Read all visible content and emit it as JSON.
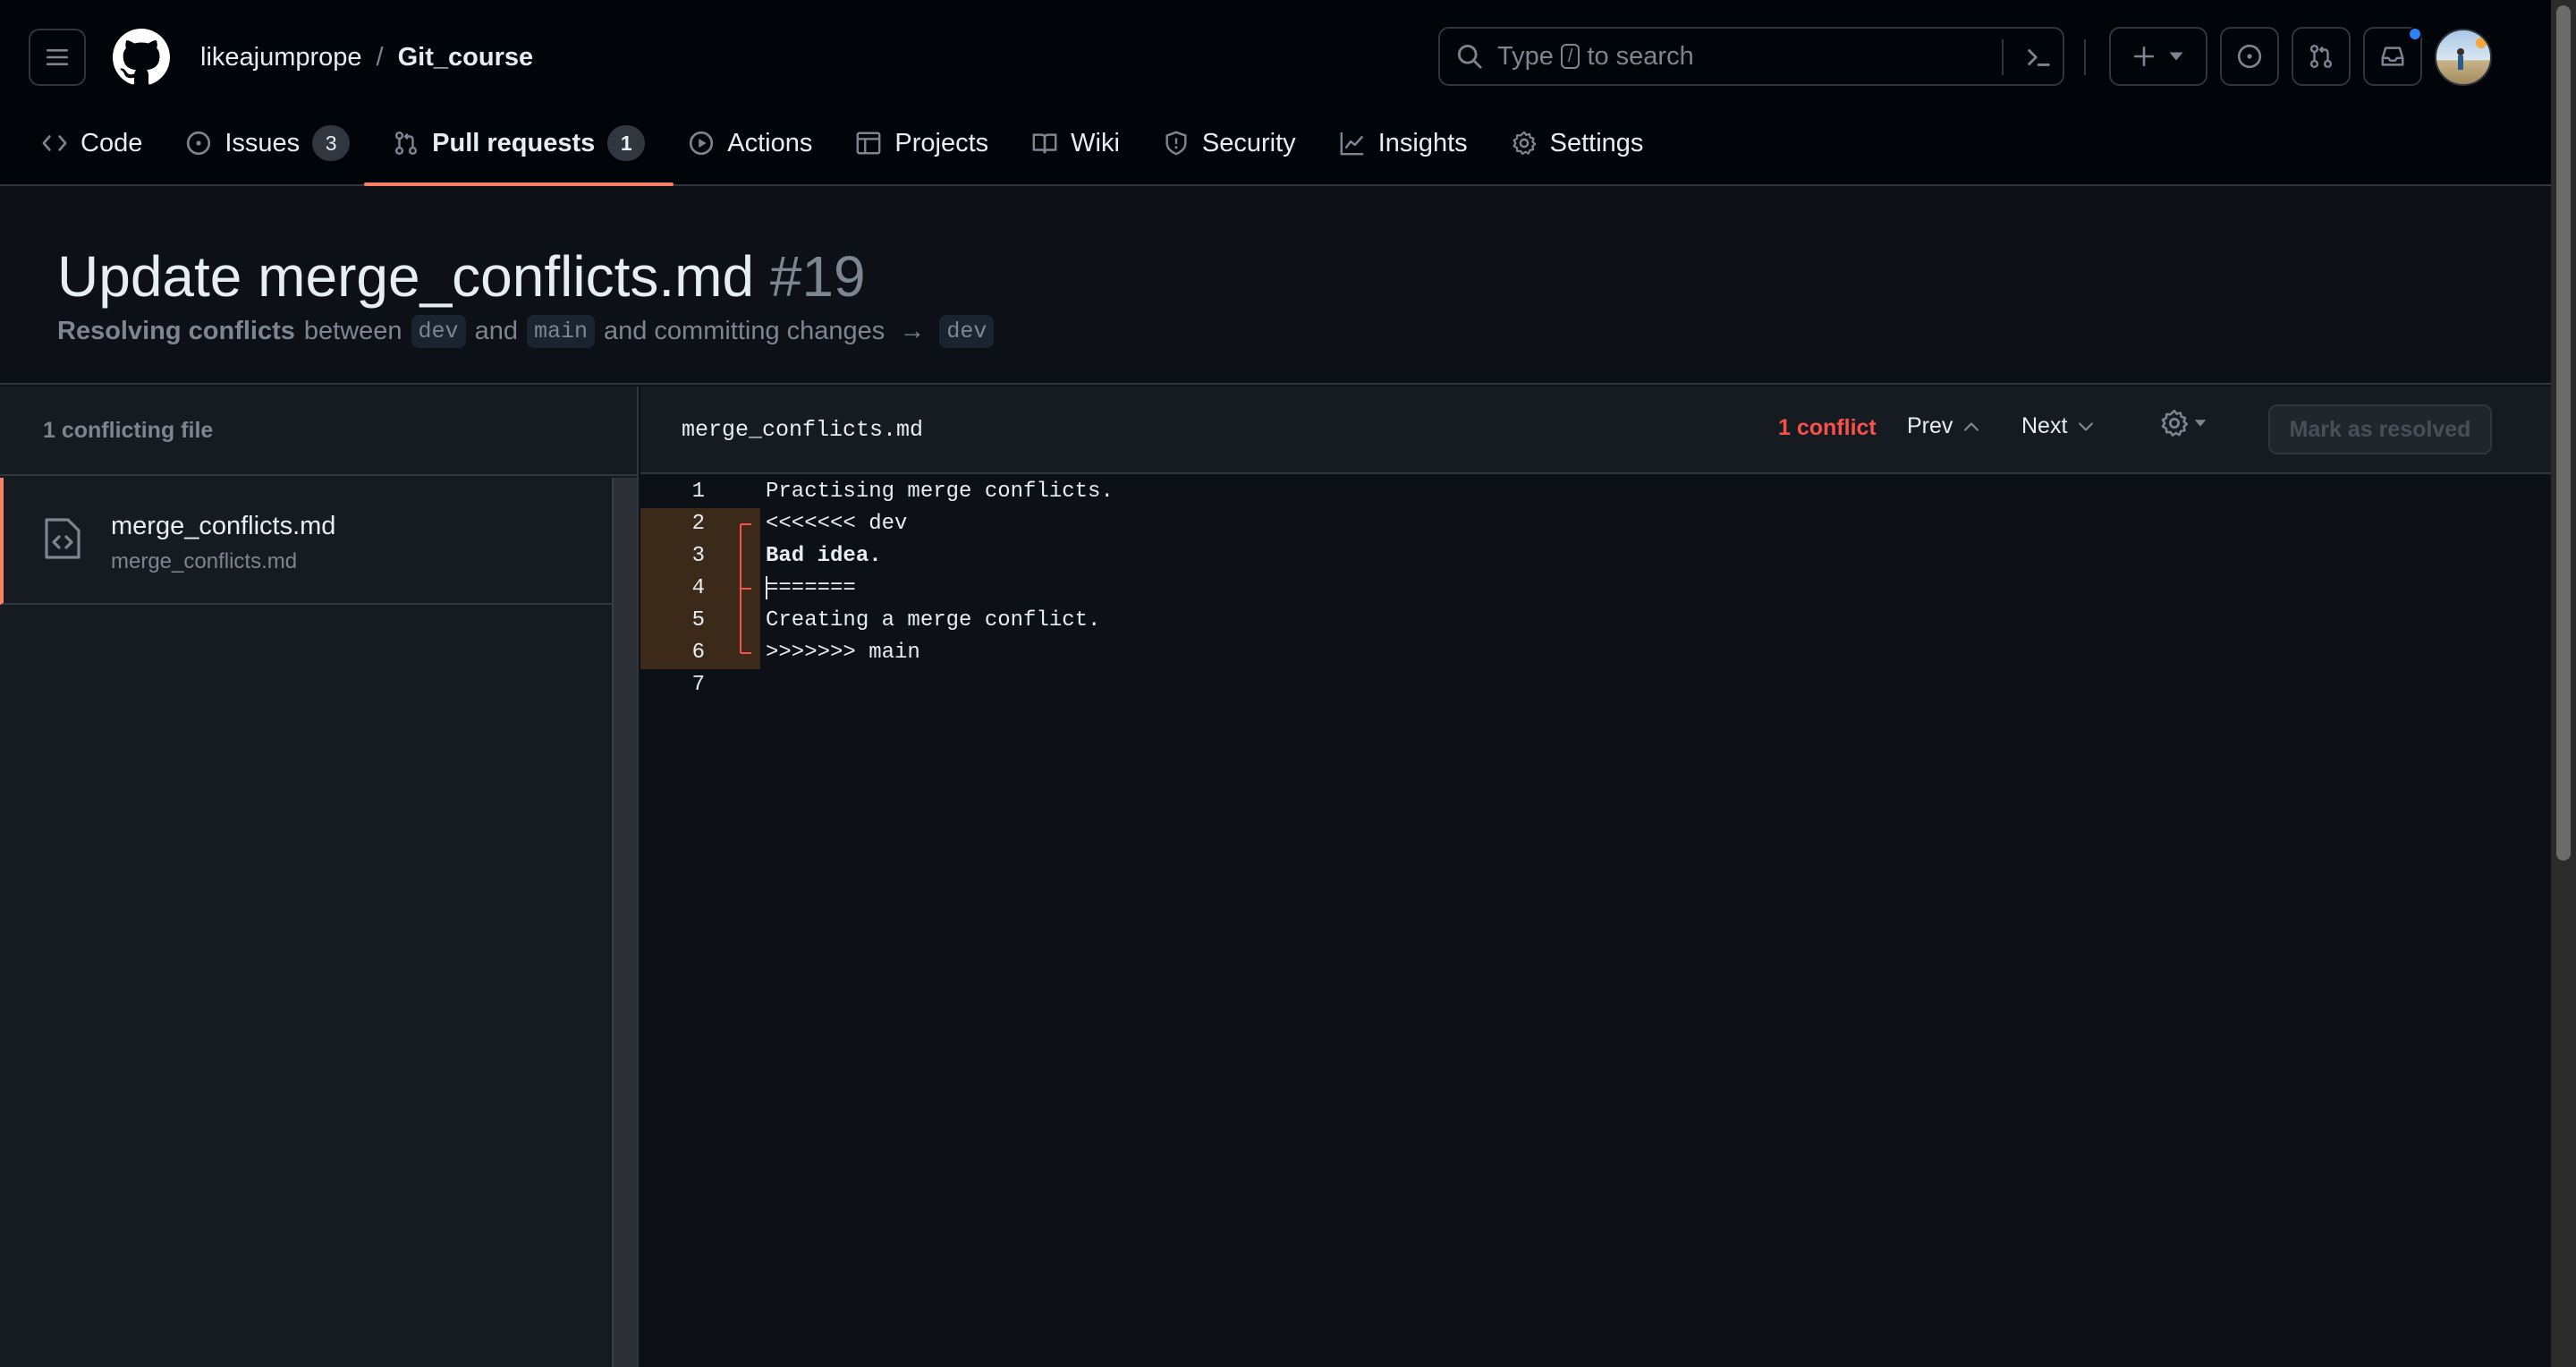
{
  "header": {
    "owner": "likeajumprope",
    "separator": "/",
    "repo": "Git_course",
    "search": {
      "prefix": "Type",
      "key": "/",
      "suffix": "to search"
    }
  },
  "tabs": [
    {
      "label": "Code",
      "icon": "code-icon"
    },
    {
      "label": "Issues",
      "icon": "issue-icon",
      "count": "3"
    },
    {
      "label": "Pull requests",
      "icon": "pull-request-icon",
      "count": "1",
      "selected": true
    },
    {
      "label": "Actions",
      "icon": "play-icon"
    },
    {
      "label": "Projects",
      "icon": "table-icon"
    },
    {
      "label": "Wiki",
      "icon": "book-icon"
    },
    {
      "label": "Security",
      "icon": "shield-icon"
    },
    {
      "label": "Insights",
      "icon": "graph-icon"
    },
    {
      "label": "Settings",
      "icon": "gear-icon"
    }
  ],
  "pr": {
    "title": "Update merge_conflicts.md",
    "number": "#19",
    "subtitle": {
      "lead": "Resolving conflicts",
      "between": "between",
      "branch_a": "dev",
      "and": "and",
      "branch_b": "main",
      "committing": "and committing changes",
      "arrow": "→",
      "target": "dev"
    }
  },
  "sidebar": {
    "heading": "1 conflicting file",
    "files": [
      {
        "name": "merge_conflicts.md",
        "path": "merge_conflicts.md"
      }
    ]
  },
  "editor": {
    "filename": "merge_conflicts.md",
    "conflict_count": "1 conflict",
    "prev_label": "Prev",
    "next_label": "Next",
    "resolve_label": "Mark as resolved",
    "lines": [
      {
        "n": "1",
        "text": "Practising merge conflicts."
      },
      {
        "n": "2",
        "text": "<<<<<<< dev"
      },
      {
        "n": "3",
        "text": "Bad idea."
      },
      {
        "n": "4",
        "text": "======="
      },
      {
        "n": "5",
        "text": "Creating a merge conflict."
      },
      {
        "n": "6",
        "text": ">>>>>>> main"
      },
      {
        "n": "7",
        "text": ""
      }
    ]
  },
  "colors": {
    "accent_underline": "#f78166",
    "conflict_red": "#f85149",
    "notification_blue": "#2f81f7"
  }
}
